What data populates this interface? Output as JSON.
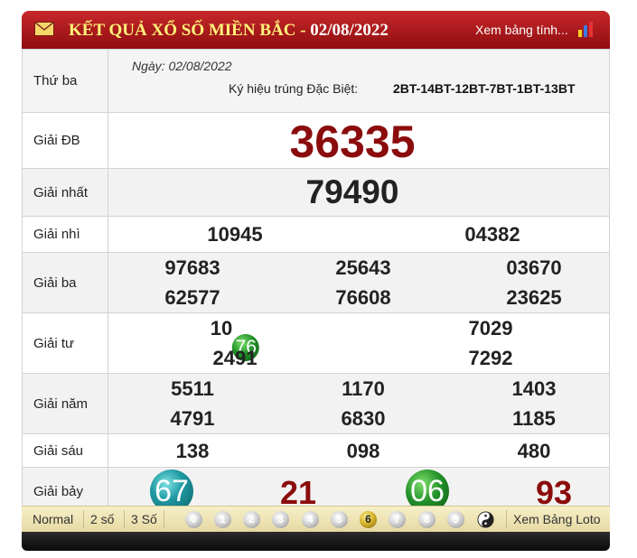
{
  "header": {
    "title": "KẾT QUẢ XỔ SỐ MIỀN BẮC",
    "separator": " - ",
    "date": "02/08/2022",
    "link": "Xem bảng tính..."
  },
  "info": {
    "weekday": "Thứ ba",
    "date_line": "Ngày: 02/08/2022",
    "symbol_label": "Ký hiệu trúng Đặc Biệt:",
    "symbol_value": "2BT-14BT-12BT-7BT-1BT-13BT"
  },
  "prizes": {
    "db": {
      "label": "Giải ĐB",
      "value": "36335"
    },
    "nhat": {
      "label": "Giải nhất",
      "value": "79490"
    },
    "nhi": {
      "label": "Giải nhì",
      "values": [
        "10945",
        "04382"
      ]
    },
    "ba": {
      "label": "Giải ba",
      "values": [
        "97683",
        "25643",
        "03670",
        "62577",
        "76608",
        "23625"
      ]
    },
    "tu": {
      "label": "Giải tư",
      "values": [
        "1076",
        "7029",
        "2491",
        "7292"
      ],
      "first_prefix": "10",
      "first_ball": "76"
    },
    "nam": {
      "label": "Giải năm",
      "values": [
        "5511",
        "1170",
        "1403",
        "4791",
        "6830",
        "1185"
      ]
    },
    "sau": {
      "label": "Giải sáu",
      "values": [
        "138",
        "098",
        "480"
      ]
    },
    "bay": {
      "label": "Giải bảy",
      "values": [
        "67",
        "21",
        "06",
        "93"
      ]
    }
  },
  "footer": {
    "modes": [
      "Normal",
      "2 số",
      "3 Số"
    ],
    "digits": [
      "0",
      "1",
      "2",
      "3",
      "4",
      "5",
      "6",
      "7",
      "8",
      "9"
    ],
    "selected_digit": "6",
    "loto_link": "Xem Bảng Loto"
  },
  "colors": {
    "header": "#b01a1d",
    "title": "#fff27a",
    "prize_db": "#8b0c0c",
    "ball_teal": "#1f9aa3",
    "ball_green": "#22922a"
  }
}
